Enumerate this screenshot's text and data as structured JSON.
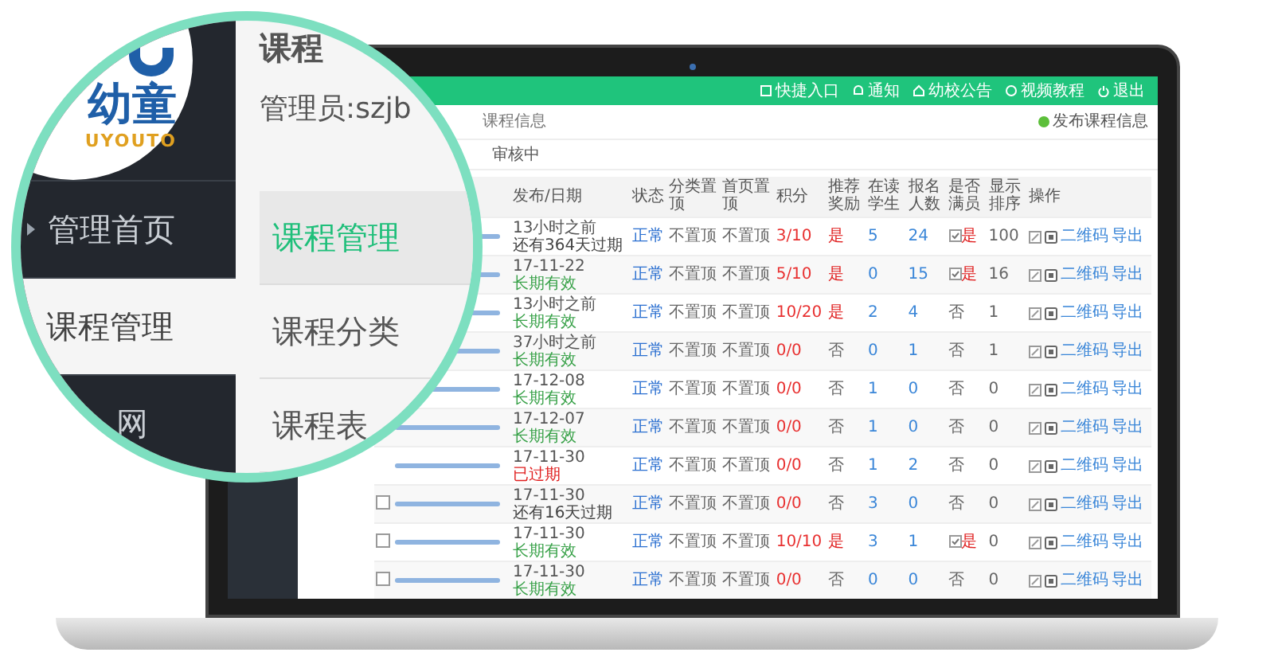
{
  "magnifier": {
    "logo": {
      "name": "幼童",
      "latin": "UYOUTO"
    },
    "sidebar": [
      {
        "label": "管理首页",
        "selected": false
      },
      {
        "label": "课程管理",
        "selected": true
      },
      {
        "label": "网",
        "selected": false
      }
    ],
    "page_title": "课程",
    "admin": "管理员:szjb",
    "submenu": [
      {
        "label": "课程管理",
        "selected": true
      },
      {
        "label": "课程分类",
        "selected": false
      },
      {
        "label": "课程表",
        "selected": false
      }
    ]
  },
  "screen": {
    "topbar": [
      "快捷入口",
      "通知",
      "幼校公告",
      "视频教程",
      "退出"
    ],
    "section_title": "课程信息",
    "publish_button": "发布课程信息",
    "filter_tab": "审核中",
    "columns": [
      "发布/日期",
      "状态",
      "分类置顶",
      "首页置顶",
      "积分",
      "推荐奖励",
      "在读学生",
      "报名人数",
      "是否满员",
      "显示排序",
      "操作"
    ],
    "rows": [
      {
        "date": "13小时之前",
        "validity": "还有364天过期",
        "color": "#444444",
        "status": "正常",
        "cat_top": "不置顶",
        "home_top": "不置顶",
        "points": "3/10",
        "recommended": "是",
        "recommended_hot": true,
        "students": "5",
        "enrolled": "24",
        "full": "是",
        "full_box": true,
        "sort": "100",
        "ops": [
          "二维码",
          "导出"
        ]
      },
      {
        "date": "17-11-22",
        "validity": "长期有效",
        "color": "#3aa24a",
        "status": "正常",
        "cat_top": "不置顶",
        "home_top": "不置顶",
        "points": "5/10",
        "recommended": "是",
        "recommended_hot": true,
        "students": "0",
        "enrolled": "15",
        "full": "是",
        "full_box": true,
        "sort": "16",
        "ops": [
          "二维码",
          "导出"
        ]
      },
      {
        "date": "13小时之前",
        "validity": "长期有效",
        "color": "#3aa24a",
        "status": "正常",
        "cat_top": "不置顶",
        "home_top": "不置顶",
        "points": "10/20",
        "recommended": "是",
        "recommended_hot": true,
        "students": "2",
        "enrolled": "4",
        "full": "否",
        "full_box": false,
        "sort": "1",
        "ops": [
          "二维码",
          "导出"
        ]
      },
      {
        "date": "37小时之前",
        "validity": "长期有效",
        "color": "#3aa24a",
        "status": "正常",
        "cat_top": "不置顶",
        "home_top": "不置顶",
        "points": "0/0",
        "recommended": "否",
        "recommended_hot": false,
        "students": "0",
        "enrolled": "1",
        "full": "否",
        "full_box": false,
        "sort": "1",
        "ops": [
          "二维码",
          "导出"
        ]
      },
      {
        "date": "17-12-08",
        "validity": "长期有效",
        "color": "#3aa24a",
        "status": "正常",
        "cat_top": "不置顶",
        "home_top": "不置顶",
        "points": "0/0",
        "recommended": "否",
        "recommended_hot": false,
        "students": "1",
        "enrolled": "0",
        "full": "否",
        "full_box": false,
        "sort": "0",
        "ops": [
          "二维码",
          "导出"
        ]
      },
      {
        "date": "17-12-07",
        "validity": "长期有效",
        "color": "#3aa24a",
        "status": "正常",
        "cat_top": "不置顶",
        "home_top": "不置顶",
        "points": "0/0",
        "recommended": "否",
        "recommended_hot": false,
        "students": "1",
        "enrolled": "0",
        "full": "否",
        "full_box": false,
        "sort": "0",
        "ops": [
          "二维码",
          "导出"
        ]
      },
      {
        "date": "17-11-30",
        "validity": "已过期",
        "color": "#e02020",
        "status": "正常",
        "cat_top": "不置顶",
        "home_top": "不置顶",
        "points": "0/0",
        "recommended": "否",
        "recommended_hot": false,
        "students": "1",
        "enrolled": "2",
        "full": "否",
        "full_box": false,
        "sort": "0",
        "ops": [
          "二维码",
          "导出"
        ]
      },
      {
        "selected": false,
        "date": "17-11-30",
        "validity": "还有16天过期",
        "color": "#444444",
        "status": "正常",
        "cat_top": "不置顶",
        "home_top": "不置顶",
        "points": "0/0",
        "recommended": "否",
        "recommended_hot": false,
        "students": "3",
        "enrolled": "0",
        "full": "否",
        "full_box": false,
        "sort": "0",
        "ops": [
          "二维码",
          "导出"
        ]
      },
      {
        "selected": false,
        "date": "17-11-30",
        "validity": "长期有效",
        "color": "#3aa24a",
        "status": "正常",
        "cat_top": "不置顶",
        "home_top": "不置顶",
        "points": "10/10",
        "recommended": "是",
        "recommended_hot": true,
        "students": "3",
        "enrolled": "1",
        "full": "是",
        "full_box": true,
        "sort": "0",
        "ops": [
          "二维码",
          "导出"
        ]
      },
      {
        "selected": false,
        "date": "17-11-30",
        "validity": "长期有效",
        "color": "#3aa24a",
        "status": "正常",
        "cat_top": "不置顶",
        "home_top": "不置顶",
        "points": "0/0",
        "recommended": "否",
        "recommended_hot": false,
        "students": "0",
        "enrolled": "0",
        "full": "否",
        "full_box": false,
        "sort": "0",
        "ops": [
          "二维码",
          "导出"
        ]
      }
    ]
  }
}
